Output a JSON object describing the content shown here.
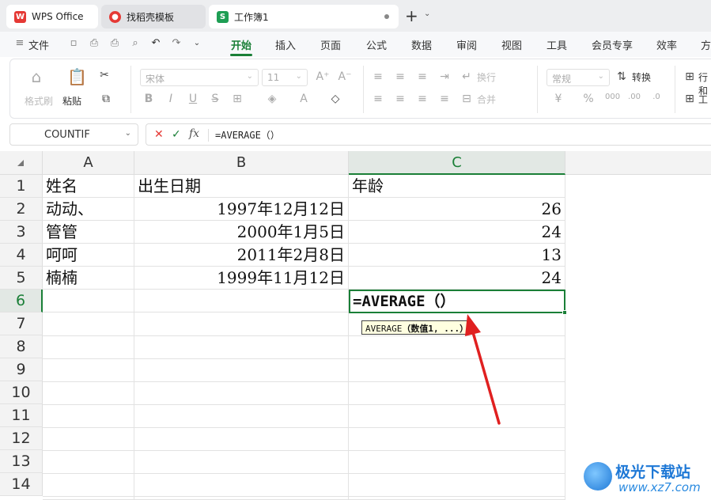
{
  "tabs": {
    "wps": "WPS Office",
    "template": "找稻壳模板",
    "workbook": "工作簿1",
    "workbook_icon": "S",
    "add": "+"
  },
  "menu": {
    "file": "文件",
    "tabs": [
      "开始",
      "插入",
      "页面",
      "公式",
      "数据",
      "审阅",
      "视图",
      "工具",
      "会员专享",
      "效率",
      "方"
    ]
  },
  "ribbon": {
    "format_painter": "格式刷",
    "paste": "粘贴",
    "font_name": "宋体",
    "font_size": "11",
    "wrap": "换行",
    "merge": "合并",
    "number_format": "常规",
    "convert": "转换",
    "row_col": "行和",
    "worksheet": "工"
  },
  "formula_bar": {
    "name_box": "COUNTIF",
    "formula": "=AVERAGE（）",
    "fx": "fx"
  },
  "columns": [
    "A",
    "B",
    "C"
  ],
  "rows": [
    "1",
    "2",
    "3",
    "4",
    "5",
    "6",
    "7",
    "8",
    "9",
    "10",
    "11",
    "12",
    "13",
    "14"
  ],
  "cells": {
    "header": [
      "姓名",
      "出生日期",
      "年龄"
    ],
    "data": [
      [
        "动动、",
        "1997年12月12日",
        "26"
      ],
      [
        "管管",
        "2000年1月5日",
        "24"
      ],
      [
        "呵呵",
        "2011年2月8日",
        "13"
      ],
      [
        "楠楠",
        "1999年11月12日",
        "24"
      ]
    ],
    "active_value": "=AVERAGE（）"
  },
  "tooltip": {
    "fn": "AVERAGE",
    "args": "（数值1, ...）"
  },
  "watermark": {
    "title": "极光下载站",
    "url": "www.xz7.com"
  },
  "colors": {
    "accent": "#1a7f37",
    "annotation_arrow": "#e02020",
    "tooltip_bg": "#ffffe0"
  }
}
